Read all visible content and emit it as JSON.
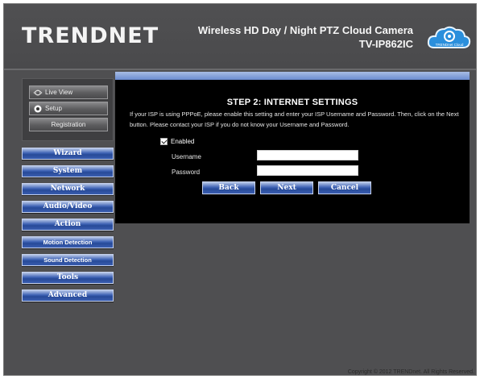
{
  "header": {
    "logo": "TRENDNET",
    "product_line1": "Wireless HD Day / Night PTZ Cloud Camera",
    "product_line2": "TV-IP862IC",
    "cloud_badge": "TRENDnet Cloud"
  },
  "sidebar_top": {
    "live_view": "Live View",
    "setup": "Setup",
    "registration": "Registration"
  },
  "nav": {
    "items": [
      "Wizard",
      "System",
      "Network",
      "Audio/Video",
      "Action",
      "Motion Detection",
      "Sound Detection",
      "Tools",
      "Advanced"
    ]
  },
  "step": {
    "title": "STEP 2: INTERNET SETTINGS",
    "description": "If your ISP is using PPPoE, please enable this setting and enter your ISP Username and Password. Then, click on the Next button. Please contact your ISP if you do not know your Username and Password.",
    "enabled_label": "Enabled",
    "enabled_checked": true,
    "username_label": "Username",
    "username_value": "",
    "password_label": "Password",
    "password_value": ""
  },
  "buttons": {
    "back": "Back",
    "next": "Next",
    "cancel": "Cancel"
  },
  "footer": {
    "copyright": "Copyright © 2012 TRENDnet. All Rights Reserved."
  },
  "colors": {
    "background": "#4f4f51",
    "panel": "#000000",
    "nav_blue": "#2d52a4",
    "accent_bar": "#8aa6dc"
  }
}
